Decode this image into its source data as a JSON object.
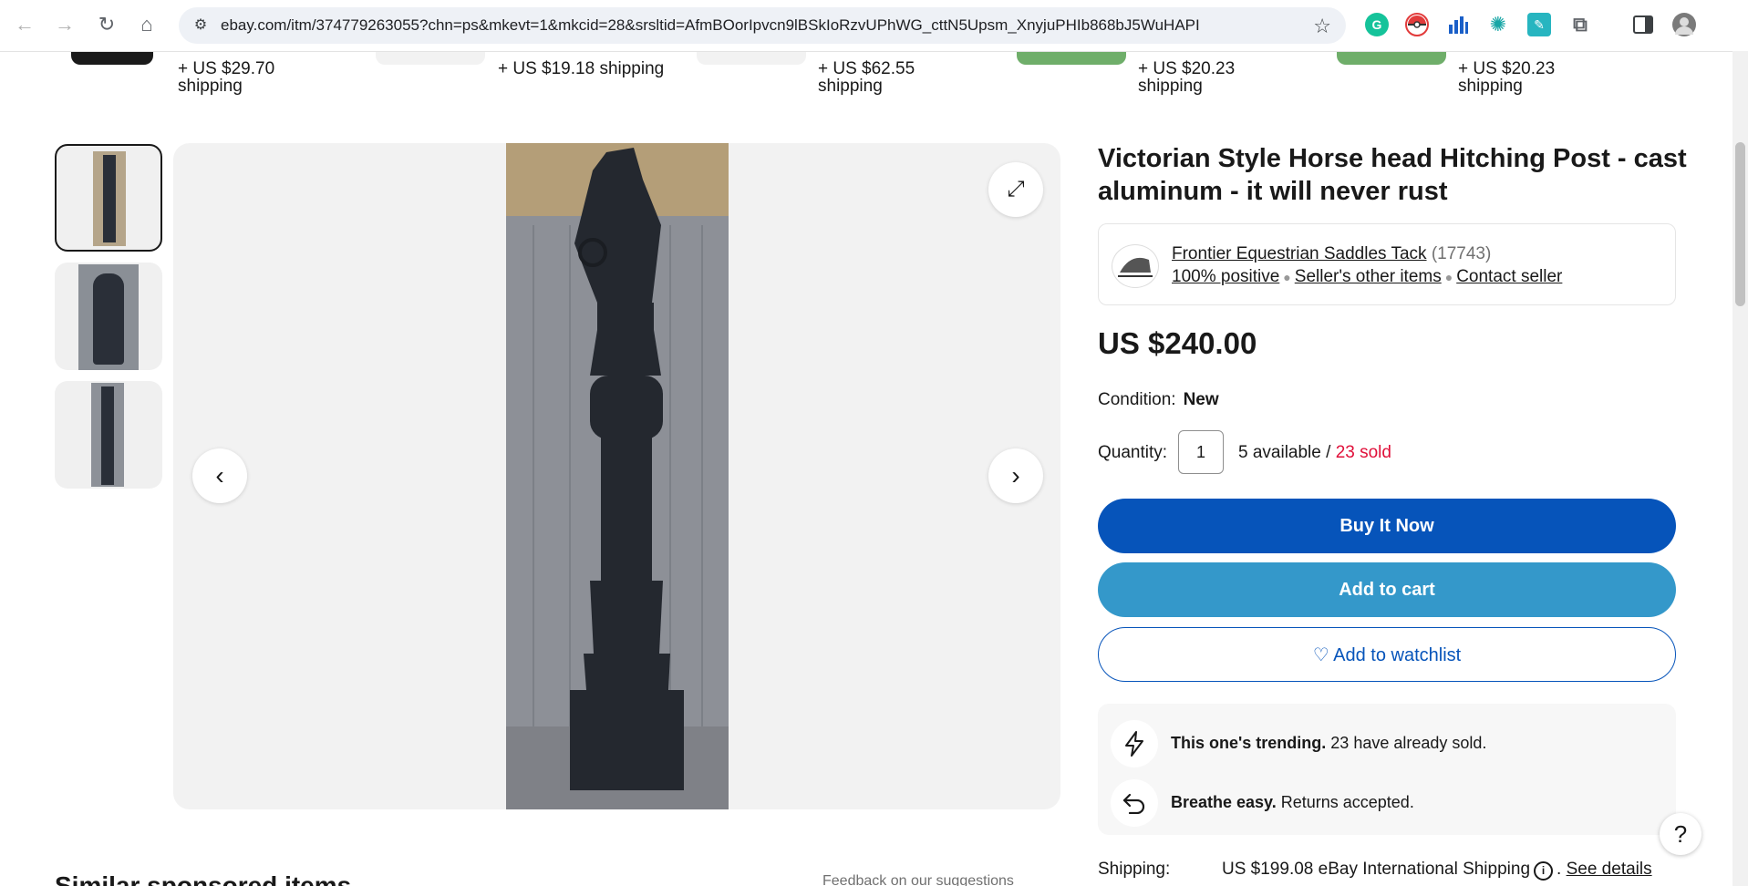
{
  "browser": {
    "url": "ebay.com/itm/374779263055?chn=ps&mkevt=1&mkcid=28&srsltid=AfmBOorIpvcn9lBSkIoRzvUPhWG_cttN5Upsm_XnyjuPHIb868bJ5WuHAPI",
    "icons": [
      "back-icon",
      "forward-icon",
      "reload-icon",
      "home-icon",
      "site-info-icon",
      "bookmark-star-icon"
    ]
  },
  "carousel": {
    "shipping": [
      {
        "price": "+ US $29.70",
        "label": "shipping"
      },
      {
        "price": "+ US $19.18 shipping",
        "label": ""
      },
      {
        "price": "+ US $62.55",
        "label": "shipping"
      },
      {
        "price": "+ US $20.23",
        "label": "shipping"
      },
      {
        "price": "+ US $20.23",
        "label": "shipping"
      }
    ]
  },
  "gallery": {
    "prev_icon": "‹",
    "next_icon": "›",
    "expand_icon": "⤢"
  },
  "item": {
    "title": "Victorian Style Horse head Hitching Post - cast aluminum - it will never rust",
    "price": "US $240.00",
    "condition_label": "Condition:",
    "condition_value": "New",
    "quantity_label": "Quantity:",
    "quantity_value": "1",
    "available": "5 available /",
    "sold": "23 sold"
  },
  "seller": {
    "name": "Frontier Equestrian Saddles Tack",
    "feedback_count": "(17743)",
    "positive": "100% positive",
    "other_items": "Seller's other items",
    "contact": "Contact seller"
  },
  "buttons": {
    "buy_now": "Buy It Now",
    "add_to_cart": "Add to cart",
    "watchlist": "♡ Add to watchlist"
  },
  "signals": [
    {
      "bold": "This one's trending.",
      "text": " 23 have already sold."
    },
    {
      "bold": "Breathe easy.",
      "text": " Returns accepted."
    }
  ],
  "shipping": {
    "label": "Shipping:",
    "value": "US $199.08 eBay International Shipping",
    "see_details": "See details"
  },
  "bottom": {
    "similar": "Similar sponsored items",
    "feedback": "Feedback on our suggestions"
  },
  "colors": {
    "buy_now": "#0654ba",
    "add_to_cart": "#3498ca",
    "sold": "#e0103a"
  }
}
